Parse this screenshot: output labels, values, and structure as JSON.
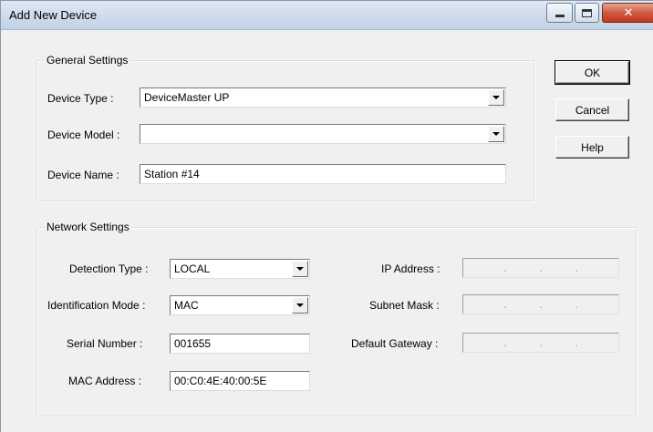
{
  "window": {
    "title": "Add New Device",
    "controls": {
      "minimize": "minimize-icon",
      "maximize": "maximize-icon",
      "close": "close-icon"
    }
  },
  "general": {
    "legend": "General Settings",
    "device_type_label": "Device Type :",
    "device_type_value": "DeviceMaster UP",
    "device_model_label": "Device Model :",
    "device_model_value": "",
    "device_name_label": "Device Name :",
    "device_name_value": "Station #14"
  },
  "buttons": {
    "ok": "OK",
    "cancel": "Cancel",
    "help": "Help"
  },
  "network": {
    "legend": "Network Settings",
    "detection_type_label": "Detection Type :",
    "detection_type_value": "LOCAL",
    "identification_mode_label": "Identification Mode :",
    "identification_mode_value": "MAC",
    "serial_number_label": "Serial Number :",
    "serial_number_value": "001655",
    "mac_address_label": "MAC Address :",
    "mac_address_value": "00:C0:4E:40:00:5E",
    "ip_address_label": "IP Address :",
    "subnet_mask_label": "Subnet Mask :",
    "default_gateway_label": "Default Gateway :",
    "ip_separator": "."
  }
}
